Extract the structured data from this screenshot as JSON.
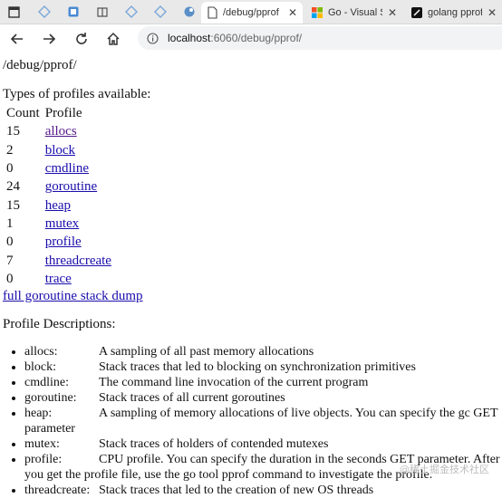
{
  "tabs": [
    {
      "label": "",
      "kind": "pinned"
    },
    {
      "label": "",
      "kind": "pinned"
    },
    {
      "label": "",
      "kind": "pinned"
    },
    {
      "label": "",
      "kind": "pinned"
    },
    {
      "label": "",
      "kind": "pinned"
    },
    {
      "label": "",
      "kind": "pinned"
    },
    {
      "label": "/debug/pprof",
      "kind": "active"
    },
    {
      "label": "Go - Visual S",
      "kind": "normal"
    },
    {
      "label": "golang pprof",
      "kind": "normal"
    }
  ],
  "address": {
    "host": "localhost",
    "path": ":6060/debug/pprof/"
  },
  "page": {
    "heading": "/debug/pprof/",
    "types_title": "Types of profiles available:",
    "col_count": "Count",
    "col_profile": "Profile",
    "profiles": [
      {
        "count": "15",
        "name": "allocs"
      },
      {
        "count": "2",
        "name": "block"
      },
      {
        "count": "0",
        "name": "cmdline"
      },
      {
        "count": "24",
        "name": "goroutine"
      },
      {
        "count": "15",
        "name": "heap"
      },
      {
        "count": "1",
        "name": "mutex"
      },
      {
        "count": "0",
        "name": "profile"
      },
      {
        "count": "7",
        "name": "threadcreate"
      },
      {
        "count": "0",
        "name": "trace"
      }
    ],
    "stack_dump": "full goroutine stack dump",
    "desc_title": "Profile Descriptions:",
    "descriptions": [
      {
        "key": "allocs:",
        "text": "A sampling of all past memory allocations"
      },
      {
        "key": "block:",
        "text": "Stack traces that led to blocking on synchronization primitives"
      },
      {
        "key": "cmdline:",
        "text": "The command line invocation of the current program"
      },
      {
        "key": "goroutine:",
        "text": "Stack traces of all current goroutines"
      },
      {
        "key": "heap:",
        "text": "A sampling of memory allocations of live objects. You can specify the gc GET parameter"
      },
      {
        "key": "mutex:",
        "text": "Stack traces of holders of contended mutexes"
      },
      {
        "key": "profile:",
        "text": "CPU profile. You can specify the duration in the seconds GET parameter. After you get the profile file, use the go tool pprof command to investigate the profile."
      },
      {
        "key": "threadcreate:",
        "text": "Stack traces that led to the creation of new OS threads"
      }
    ]
  },
  "watermark": "@稀土掘金技术社区",
  "colors": {
    "link": "#1a0dab",
    "visited": "#551a8b"
  }
}
